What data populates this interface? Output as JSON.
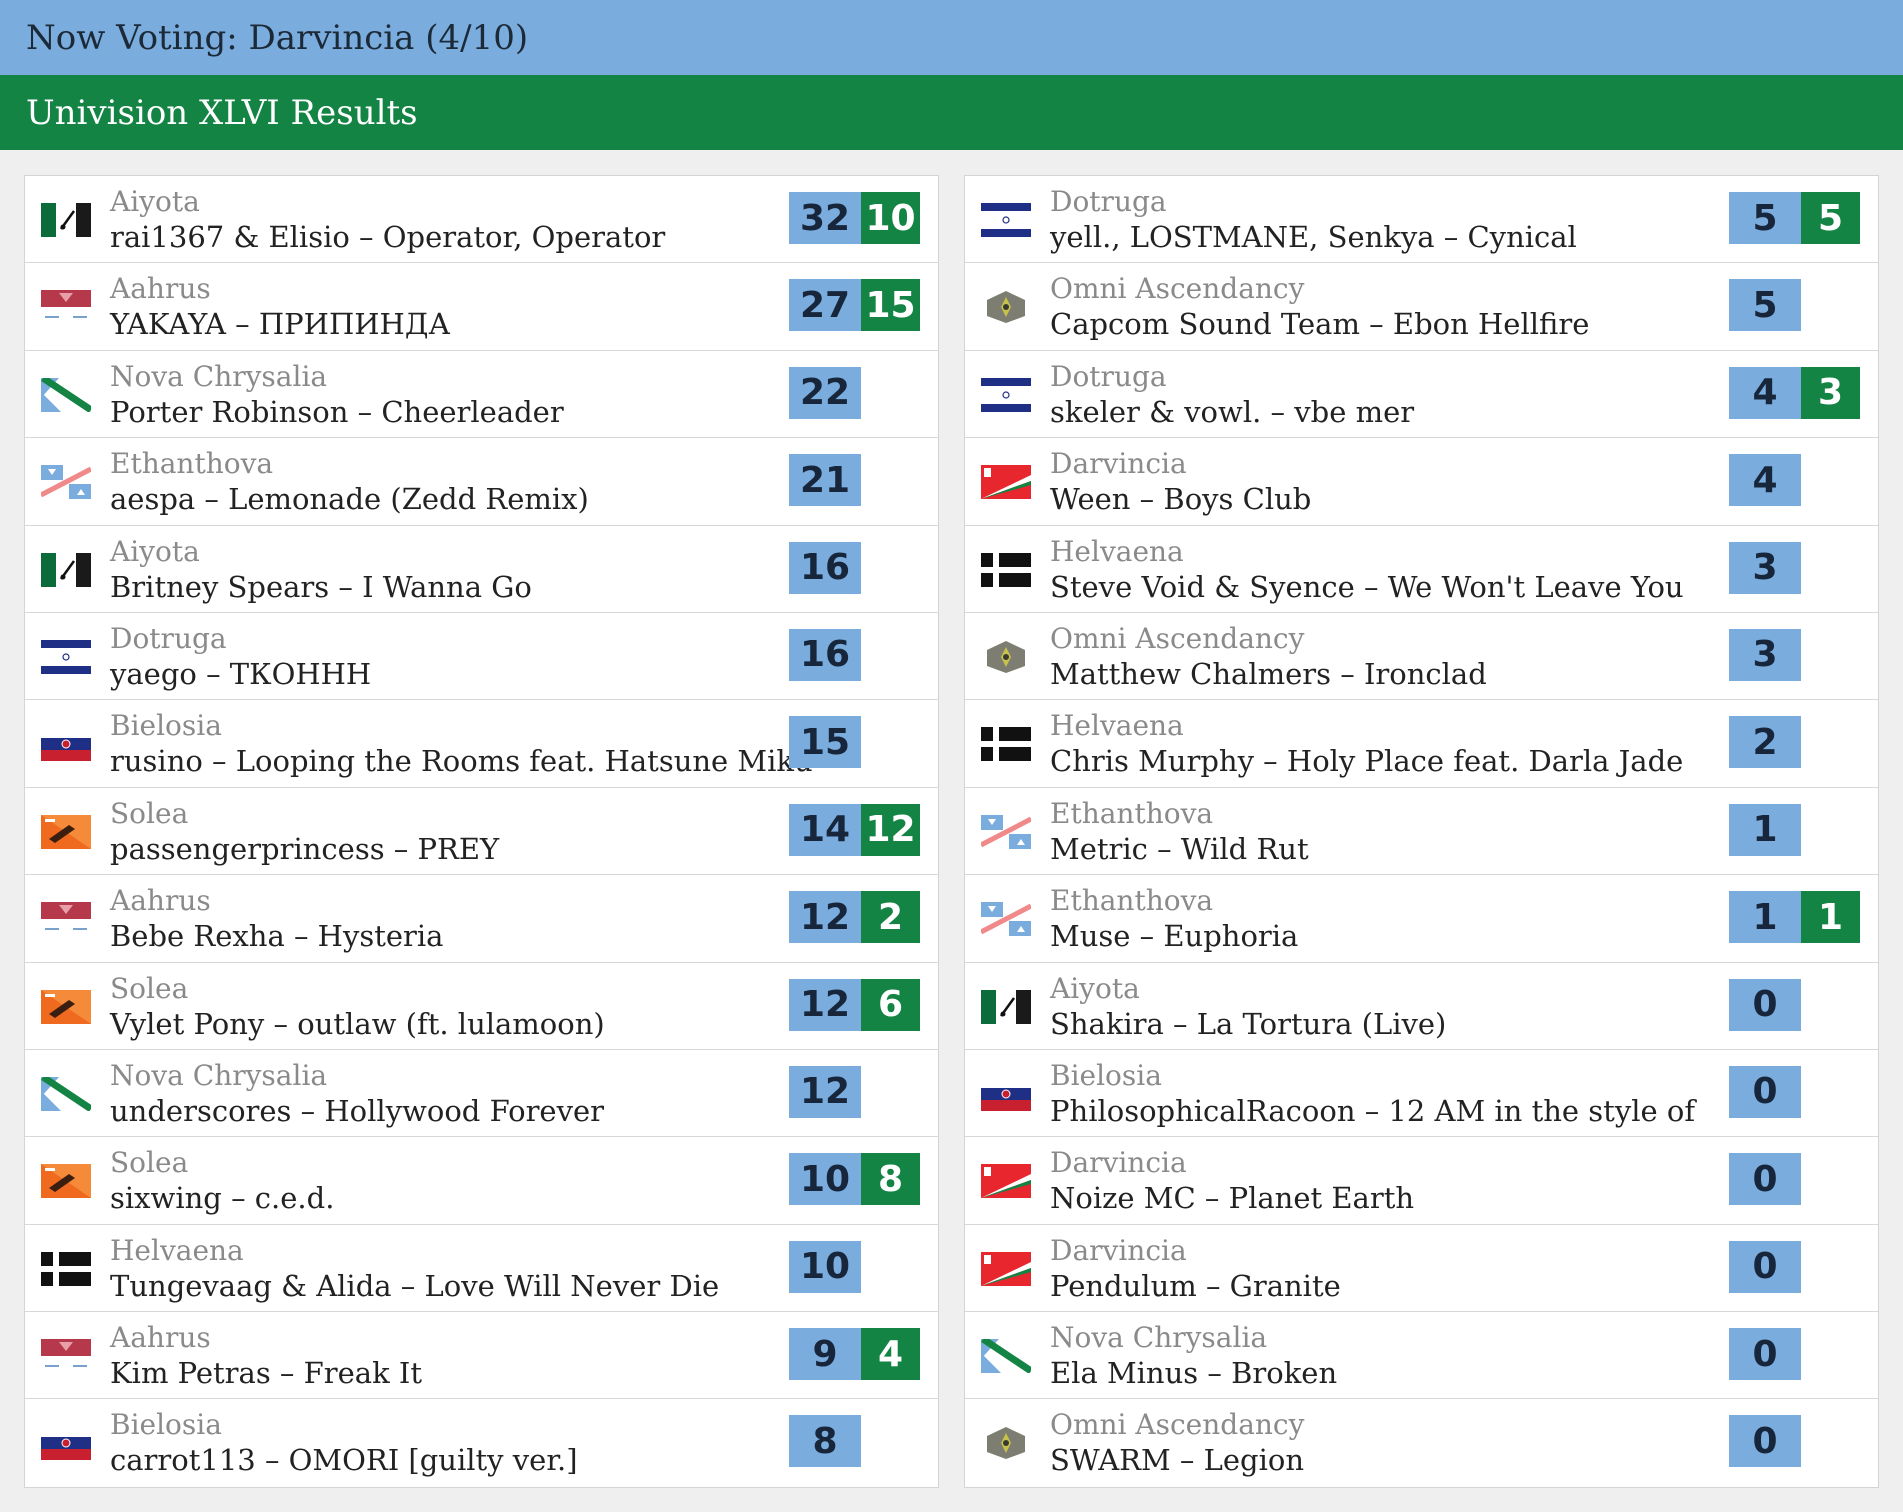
{
  "header": {
    "now_voting": "Now Voting: Darvincia (4/10)"
  },
  "results": {
    "title": "Univision XLVI Results"
  },
  "colors": {
    "top_bar": "#7aacde",
    "results_bar": "#138443",
    "total_badge": "#7aacde",
    "jury_badge": "#138443"
  },
  "left": [
    {
      "country": "Aiyota",
      "song": "rai1367 & Elisio – Operator, Operator",
      "flag": "aiyota",
      "total": "32",
      "jury": "10"
    },
    {
      "country": "Aahrus",
      "song": "YAKAYA – ПРИПИНДА",
      "flag": "aahrus",
      "total": "27",
      "jury": "15"
    },
    {
      "country": "Nova Chrysalia",
      "song": "Porter Robinson – Cheerleader",
      "flag": "nova",
      "total": "22",
      "jury": ""
    },
    {
      "country": "Ethanthova",
      "song": "aespa – Lemonade (Zedd Remix)",
      "flag": "ethanthova",
      "total": "21",
      "jury": ""
    },
    {
      "country": "Aiyota",
      "song": "Britney Spears – I Wanna Go",
      "flag": "aiyota",
      "total": "16",
      "jury": ""
    },
    {
      "country": "Dotruga",
      "song": "yaego – ТКОННН",
      "flag": "dotruga",
      "total": "16",
      "jury": ""
    },
    {
      "country": "Bielosia",
      "song": "rusino – Looping the Rooms feat. Hatsune Miku",
      "flag": "bielosia",
      "total": "15",
      "jury": ""
    },
    {
      "country": "Solea",
      "song": "passengerprincess – PREY",
      "flag": "solea",
      "total": "14",
      "jury": "12"
    },
    {
      "country": "Aahrus",
      "song": "Bebe Rexha – Hysteria",
      "flag": "aahrus",
      "total": "12",
      "jury": "2"
    },
    {
      "country": "Solea",
      "song": "Vylet Pony – outlaw (ft. lulamoon)",
      "flag": "solea",
      "total": "12",
      "jury": "6"
    },
    {
      "country": "Nova Chrysalia",
      "song": "underscores – Hollywood Forever",
      "flag": "nova",
      "total": "12",
      "jury": ""
    },
    {
      "country": "Solea",
      "song": "sixwing – c.e.d.",
      "flag": "solea",
      "total": "10",
      "jury": "8"
    },
    {
      "country": "Helvaena",
      "song": "Tungevaag & Alida – Love Will Never Die",
      "flag": "helvaena",
      "total": "10",
      "jury": ""
    },
    {
      "country": "Aahrus",
      "song": "Kim Petras – Freak It",
      "flag": "aahrus",
      "total": "9",
      "jury": "4"
    },
    {
      "country": "Bielosia",
      "song": "carrot113 – OMORI [guilty ver.]",
      "flag": "bielosia",
      "total": "8",
      "jury": ""
    }
  ],
  "right": [
    {
      "country": "Dotruga",
      "song": "yell., LOSTMANE, Senkya – Cynical",
      "flag": "dotruga",
      "total": "5",
      "jury": "5"
    },
    {
      "country": "Omni Ascendancy",
      "song": "Capcom Sound Team – Ebon Hellfire",
      "flag": "omni",
      "total": "5",
      "jury": ""
    },
    {
      "country": "Dotruga",
      "song": "skeler & vowl. – vbe mer",
      "flag": "dotruga",
      "total": "4",
      "jury": "3"
    },
    {
      "country": "Darvincia",
      "song": "Ween – Boys Club",
      "flag": "darvincia",
      "total": "4",
      "jury": ""
    },
    {
      "country": "Helvaena",
      "song": "Steve Void & Syence – We Won't Leave You",
      "flag": "helvaena",
      "total": "3",
      "jury": ""
    },
    {
      "country": "Omni Ascendancy",
      "song": "Matthew Chalmers – Ironclad",
      "flag": "omni",
      "total": "3",
      "jury": ""
    },
    {
      "country": "Helvaena",
      "song": "Chris Murphy – Holy Place feat. Darla Jade",
      "flag": "helvaena",
      "total": "2",
      "jury": ""
    },
    {
      "country": "Ethanthova",
      "song": "Metric – Wild Rut",
      "flag": "ethanthova",
      "total": "1",
      "jury": ""
    },
    {
      "country": "Ethanthova",
      "song": "Muse – Euphoria",
      "flag": "ethanthova",
      "total": "1",
      "jury": "1"
    },
    {
      "country": "Aiyota",
      "song": "Shakira – La Tortura (Live)",
      "flag": "aiyota",
      "total": "0",
      "jury": ""
    },
    {
      "country": "Bielosia",
      "song": "PhilosophicalRacoon – 12 AM in the style of",
      "flag": "bielosia",
      "total": "0",
      "jury": ""
    },
    {
      "country": "Darvincia",
      "song": "Noize MC – Planet Earth",
      "flag": "darvincia",
      "total": "0",
      "jury": ""
    },
    {
      "country": "Darvincia",
      "song": "Pendulum – Granite",
      "flag": "darvincia",
      "total": "0",
      "jury": ""
    },
    {
      "country": "Nova Chrysalia",
      "song": "Ela Minus – Broken",
      "flag": "nova",
      "total": "0",
      "jury": ""
    },
    {
      "country": "Omni Ascendancy",
      "song": "SWARM – Legion",
      "flag": "omni",
      "total": "0",
      "jury": ""
    }
  ]
}
